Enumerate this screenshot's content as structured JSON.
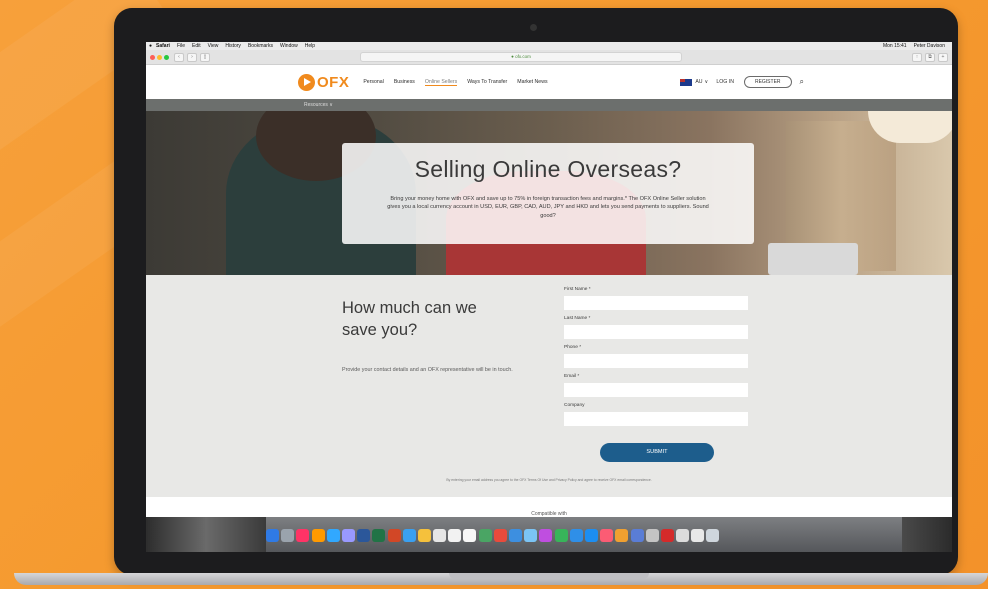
{
  "mac_menubar": {
    "items": [
      "Safari",
      "File",
      "Edit",
      "View",
      "History",
      "Bookmarks",
      "Window",
      "Help"
    ],
    "clock": "Mon 15:41",
    "user": "Peter Davison"
  },
  "browser": {
    "url": "● ofx.com"
  },
  "site": {
    "logo_text": "OFX",
    "nav": [
      "Personal",
      "Business",
      "Online Sellers",
      "Ways To Transfer",
      "Market News"
    ],
    "region": "AU",
    "login": "LOG IN",
    "register": "REGISTER",
    "subnav": "Resources ∨"
  },
  "hero": {
    "title": "Selling Online Overseas?",
    "text": "Bring your money home with OFX and save up to 75% in foreign transaction fees and margins.* The OFX Online Seller solution gives you a local currency account in USD, EUR, GBP, CAD, AUD, JPY and HKD and lets you send payments to suppliers. Sound good?"
  },
  "form": {
    "heading": "How much can we save you?",
    "description": "Provide your contact details and an OFX representative will be in touch.",
    "fields": [
      {
        "label": "First Name *",
        "value": ""
      },
      {
        "label": "Last Name *",
        "value": ""
      },
      {
        "label": "Phone *",
        "value": ""
      },
      {
        "label": "Email *",
        "value": ""
      },
      {
        "label": "Company",
        "value": ""
      }
    ],
    "submit": "SUBMIT",
    "disclaimer": "By entering your email address you agree to the OFX Terms Of Use and Privacy Policy and agree to receive OFX email correspondence."
  },
  "footer": {
    "compatible": "Compatible with"
  },
  "colors": {
    "brand_orange": "#f08a1d",
    "submit_blue": "#1d5d8c",
    "background_orange": "#f59a2f"
  }
}
